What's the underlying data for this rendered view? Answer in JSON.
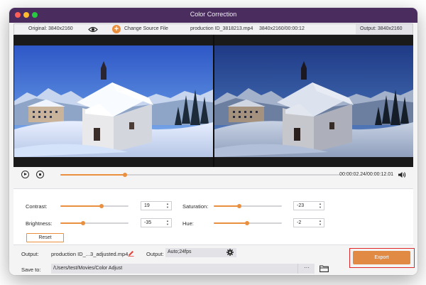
{
  "window": {
    "title": "Color Correction"
  },
  "infobar": {
    "original_label": "Original: 3840x2160",
    "change_source_label": "Change Source File",
    "filename": "production ID_3818213.mp4",
    "file_info": "3840x2160/00:00:12",
    "output_label": "Output: 3840x2160",
    "icons": [
      "eye-icon",
      "plus-icon"
    ]
  },
  "playback": {
    "progress": 0.23,
    "time": "00:00:02.24/00:00:12.01",
    "icons": [
      "play-icon",
      "stop-icon",
      "volume-icon"
    ]
  },
  "adjustments": {
    "contrast": {
      "label": "Contrast:",
      "value": "19",
      "level": 0.6
    },
    "brightness": {
      "label": "Brightness:",
      "value": "-35",
      "level": 0.33
    },
    "saturation": {
      "label": "Saturation:",
      "value": "-23",
      "level": 0.38
    },
    "hue": {
      "label": "Hue:",
      "value": "-2",
      "level": 0.49
    },
    "reset_label": "Reset"
  },
  "output": {
    "label": "Output:",
    "filename": "production ID_...3_adjusted.mp4",
    "format_label": "Output:",
    "format_value": "Auto;24fps",
    "save_label": "Save to:",
    "save_path": "/Users/test/Movies/Color Adjust",
    "browse_label": "···",
    "export_label": "Export"
  },
  "colors": {
    "accent": "#ea8f3e",
    "titlebar": "#4a2d5e",
    "highlight_border": "#e02a2a"
  }
}
